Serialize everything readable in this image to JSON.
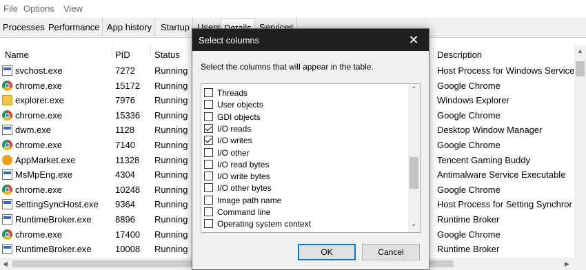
{
  "menu": [
    "File",
    "Options",
    "View"
  ],
  "tabs": [
    "Processes",
    "Performance",
    "App history",
    "Startup",
    "Users",
    "Details",
    "Services"
  ],
  "active_tab": "Details",
  "columns": {
    "name": "Name",
    "pid": "PID",
    "status": "Status",
    "description": "Description"
  },
  "rows": [
    {
      "name": "svchost.exe",
      "pid": "7272",
      "status": "Running",
      "description": "Host Process for Windows Services",
      "icon": "service-icon"
    },
    {
      "name": "chrome.exe",
      "pid": "15172",
      "status": "Running",
      "description": "Google Chrome",
      "icon": "chrome-icon"
    },
    {
      "name": "explorer.exe",
      "pid": "7976",
      "status": "Running",
      "description": "Windows Explorer",
      "icon": "folder-icon"
    },
    {
      "name": "chrome.exe",
      "pid": "15336",
      "status": "Running",
      "description": "Google Chrome",
      "icon": "chrome-icon"
    },
    {
      "name": "dwm.exe",
      "pid": "1128",
      "status": "Running",
      "description": "Desktop Window Manager",
      "icon": "service-icon"
    },
    {
      "name": "chrome.exe",
      "pid": "7140",
      "status": "Running",
      "description": "Google Chrome",
      "icon": "chrome-icon"
    },
    {
      "name": "AppMarket.exe",
      "pid": "11328",
      "status": "Running",
      "description": "Tencent Gaming Buddy",
      "icon": "game-icon"
    },
    {
      "name": "MsMpEng.exe",
      "pid": "4304",
      "status": "Running",
      "description": "Antimalware Service Executable",
      "icon": "service-icon"
    },
    {
      "name": "chrome.exe",
      "pid": "10248",
      "status": "Running",
      "description": "Google Chrome",
      "icon": "chrome-icon"
    },
    {
      "name": "SettingSyncHost.exe",
      "pid": "9364",
      "status": "Running",
      "description": "Host Process for Setting Synchror",
      "icon": "service-icon"
    },
    {
      "name": "RuntimeBroker.exe",
      "pid": "8896",
      "status": "Running",
      "description": "Runtime Broker",
      "icon": "service-icon"
    },
    {
      "name": "chrome.exe",
      "pid": "17400",
      "status": "Running",
      "description": "Google Chrome",
      "icon": "chrome-icon"
    },
    {
      "name": "RuntimeBroker.exe",
      "pid": "10008",
      "status": "Running",
      "description": "Runtime Broker",
      "icon": "service-icon"
    }
  ],
  "dialog": {
    "title": "Select columns",
    "instruction": "Select the columns that will appear in the table.",
    "items": [
      {
        "label": "Threads",
        "checked": false
      },
      {
        "label": "User objects",
        "checked": false
      },
      {
        "label": "GDI objects",
        "checked": false
      },
      {
        "label": "I/O reads",
        "checked": true
      },
      {
        "label": "I/O writes",
        "checked": true
      },
      {
        "label": "I/O other",
        "checked": false
      },
      {
        "label": "I/O read bytes",
        "checked": false
      },
      {
        "label": "I/O write bytes",
        "checked": false
      },
      {
        "label": "I/O other bytes",
        "checked": false
      },
      {
        "label": "Image path name",
        "checked": false
      },
      {
        "label": "Command line",
        "checked": false
      },
      {
        "label": "Operating system context",
        "checked": false
      }
    ],
    "ok_label": "OK",
    "cancel_label": "Cancel"
  },
  "colors": {
    "accent": "#0078d7",
    "titlebar": "#1f1f1f"
  }
}
